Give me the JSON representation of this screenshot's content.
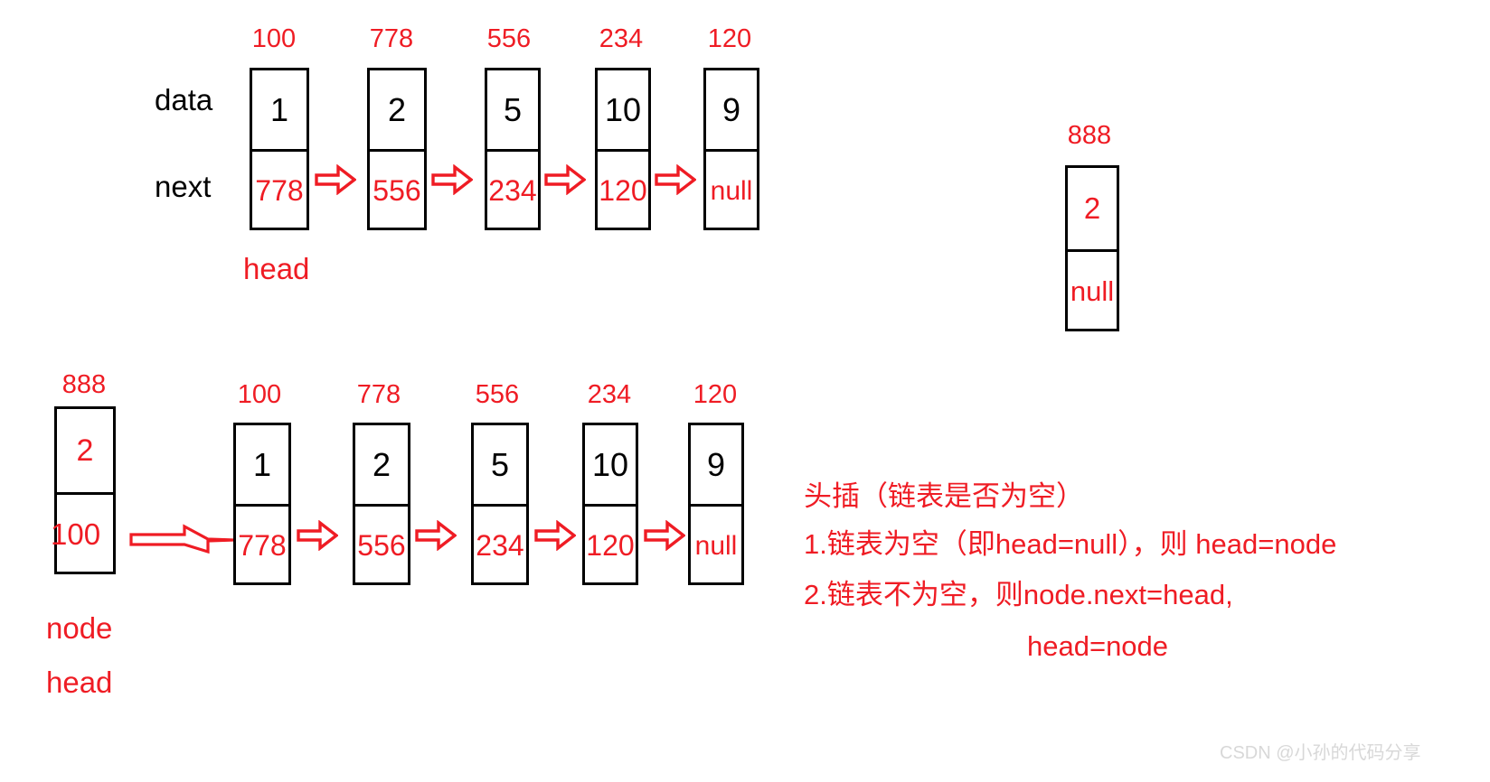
{
  "diagram": {
    "title_watermark": "CSDN @小孙的代码分享",
    "row_labels": {
      "data": "data",
      "next": "next"
    },
    "top_list": {
      "caption": "head",
      "nodes": [
        {
          "address": "100",
          "data": "1",
          "next": "778"
        },
        {
          "address": "778",
          "data": "2",
          "next": "556"
        },
        {
          "address": "556",
          "data": "5",
          "next": "234"
        },
        {
          "address": "234",
          "data": "10",
          "next": "120"
        },
        {
          "address": "120",
          "data": "9",
          "next": "null"
        }
      ]
    },
    "new_node": {
      "address": "888",
      "data": "2",
      "next": "null"
    },
    "bottom_list": {
      "labels": {
        "node": "node",
        "head": "head"
      },
      "new_node": {
        "address": "888",
        "data": "2",
        "next": "100"
      },
      "nodes": [
        {
          "address": "100",
          "data": "1",
          "next": "778"
        },
        {
          "address": "778",
          "data": "2",
          "next": "556"
        },
        {
          "address": "556",
          "data": "5",
          "next": "234"
        },
        {
          "address": "234",
          "data": "10",
          "next": "120"
        },
        {
          "address": "120",
          "data": "9",
          "next": "null"
        }
      ]
    },
    "note": {
      "line1": "头插（链表是否为空）",
      "line2": "1.链表为空（即head=null），则 head=node",
      "line3": "2.链表不为空，则node.next=head,",
      "line4": "head=node"
    },
    "colors": {
      "accent_red": "#ef1c24",
      "outline_black": "#000000",
      "watermark_gray": "#d8d8d8"
    }
  }
}
